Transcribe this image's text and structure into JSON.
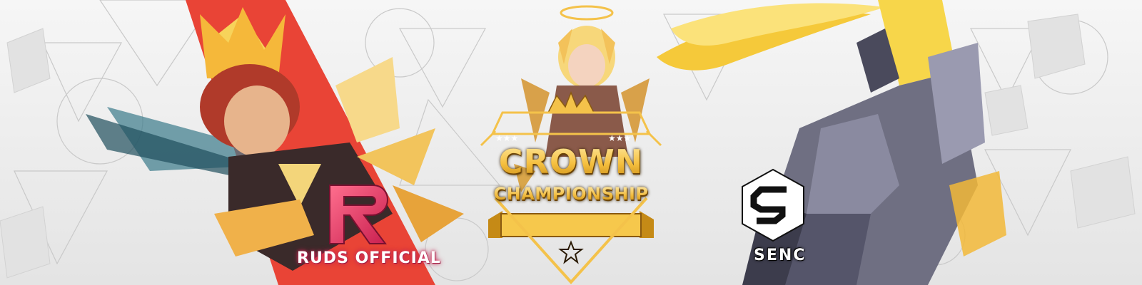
{
  "event": {
    "title_line1": "CROWN",
    "title_line2": "CHAMPIONSHIP"
  },
  "teams": {
    "left": {
      "name": "RUDS OFFICIAL",
      "logo_icon": "ruds-r-logo-icon"
    },
    "right": {
      "name": "SENC",
      "logo_icon": "senc-s-logo-icon"
    }
  },
  "colors": {
    "gold": "#f4c24a",
    "ruds_pink": "#e0406a",
    "senc_white": "#ffffff",
    "background": "#ececec"
  }
}
